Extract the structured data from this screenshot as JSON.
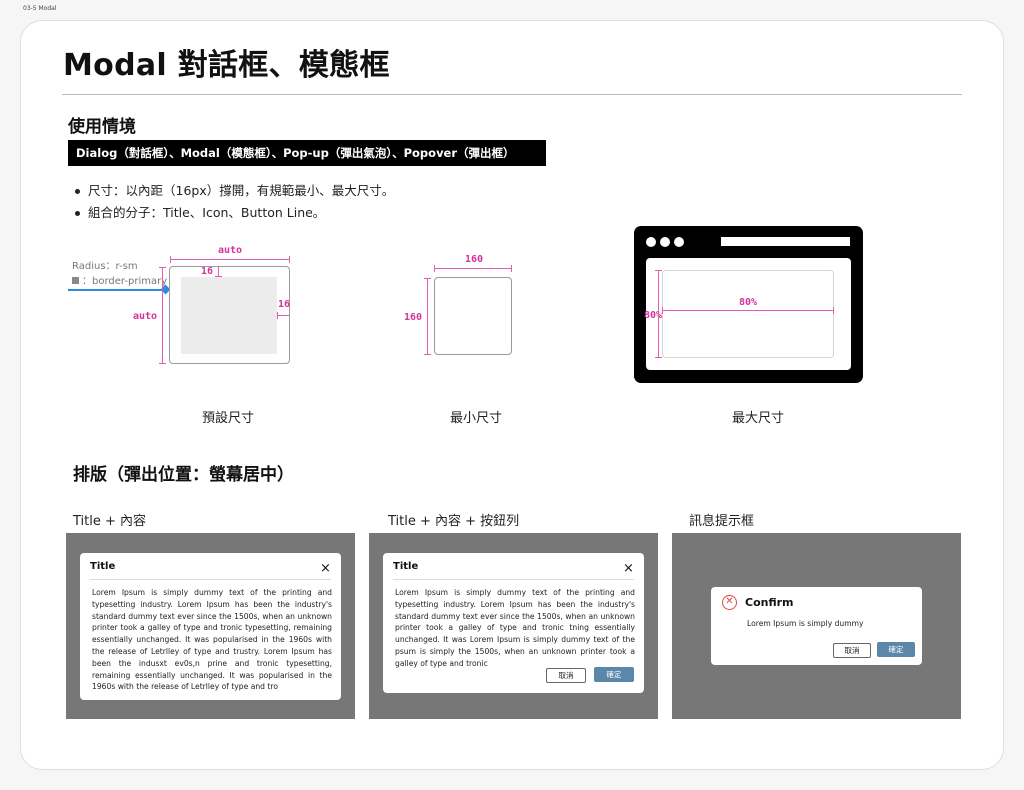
{
  "frame_label": "03-5 Modal",
  "page_title": "Modal 對話框、模態框",
  "usage": {
    "heading": "使用情境",
    "aliases": "Dialog（對話框）、Modal（模態框）、Pop-up（彈出氣泡）、Popover（彈出框）",
    "bullets": [
      "尺寸：以內距（16px）撐開，有規範最小、最大尺寸。",
      "組合的分子：Title、Icon、Button Line。"
    ]
  },
  "sizes": {
    "default": {
      "radius_note": "Radius：r-sm",
      "border_note": "：border-primary",
      "width_label": "auto",
      "height_label": "auto",
      "padding_top": "16",
      "padding_right": "16",
      "caption": "預設尺寸"
    },
    "minimum": {
      "width_label": "160",
      "height_label": "160",
      "caption": "最小尺寸"
    },
    "maximum": {
      "width_label": "80%",
      "height_label": "80%",
      "caption": "最大尺寸"
    }
  },
  "layout": {
    "heading": "排版（彈出位置：螢幕居中）",
    "variants": [
      {
        "label": "Title + 內容",
        "title": "Title",
        "close": "×",
        "body": "Lorem Ipsum is simply dummy text of the printing and typesetting industry. Lorem Ipsum has been the industry's standard dummy text ever since the 1500s, when an unknown printer took a galley of type and tronic typesetting, remaining essentially unchanged. It was popularised in the 1960s with the release of Letrlley of type and trustry. Lorem Ipsum has been the indusxt ev0s,n prine and tronic typesetting, remaining essentially unchanged. It was popularised in the 1960s with the release of Letrlley of type and tro"
      },
      {
        "label": "Title + 內容 + 按鈕列",
        "title": "Title",
        "close": "×",
        "body": "Lorem Ipsum is simply dummy text of the printing and typesetting industry. Lorem Ipsum has been the industry's standard dummy text ever since the 1500s, when an unknown printer took a galley of type and tronic tning essentially unchanged. It was Lorem Ipsum is simply dummy text of the psum is simply  the 1500s, when an unknown printer took a galley of type and tronic",
        "cancel": "取消",
        "confirm": "確定"
      },
      {
        "label": "訊息提示框",
        "title": "Confirm",
        "body": "Lorem Ipsum is simply dummy",
        "cancel": "取消",
        "confirm": "確定"
      }
    ]
  },
  "colors": {
    "annotation": "#d5339b",
    "primary_button": "#5b87a8",
    "error_icon": "#e0473f",
    "accent_blue": "#2a8be0",
    "overlay": "#777777"
  }
}
